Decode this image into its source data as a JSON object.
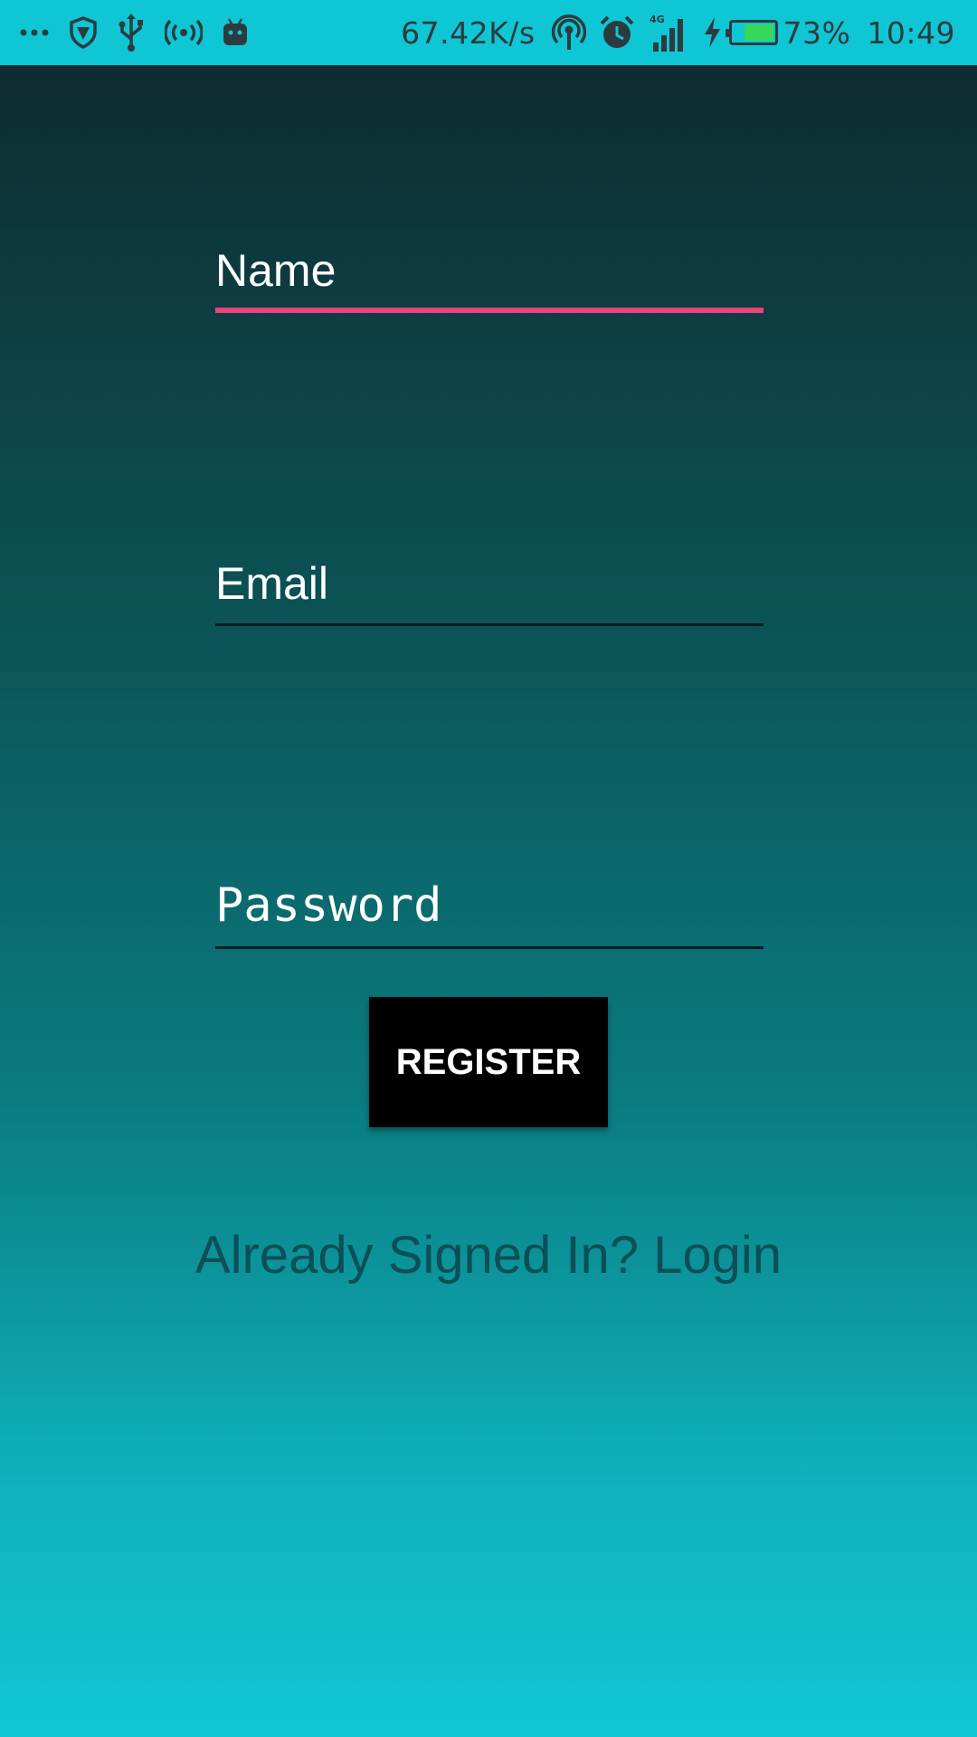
{
  "status_bar": {
    "left_icons": [
      "more-dots-icon",
      "shield-icon",
      "usb-icon",
      "hotspot-signal-icon",
      "android-debug-icon"
    ],
    "net_speed": "67.42K/s",
    "right_icons": [
      "wireless-hotspot-icon",
      "alarm-icon",
      "cell-signal-icon",
      "charging-bolt-icon"
    ],
    "battery_percent": "73%",
    "battery_level": 0.73,
    "time": "10:49"
  },
  "form": {
    "name_placeholder": "Name",
    "email_placeholder": "Email",
    "password_placeholder": "Password",
    "register_label": "REGISTER",
    "login_link": "Already Signed In? Login"
  },
  "colors": {
    "status_bar_bg": "#0fc6d4",
    "gradient_top": "#0e2c31",
    "gradient_bottom": "#10c7d4",
    "focus_underline": "#ea4279",
    "button_bg": "#000000",
    "link_text": "#0b4f57"
  }
}
